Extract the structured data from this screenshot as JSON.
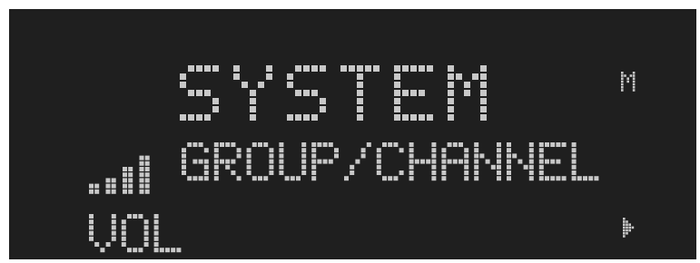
{
  "display": {
    "title": "SYSTEM",
    "subtitle": "GROUP/CHANNEL",
    "volume_label": "VOL",
    "mode_indicator": "M",
    "nav_indicator": "▶",
    "volume_level": {
      "bars_lit": 4,
      "bars_total": 4
    }
  },
  "colors": {
    "background": "#1f1f1f",
    "pixel_on": "#c8c8c8",
    "frame": "#ffffff"
  },
  "icons": {
    "volume": "signal-bars-icon",
    "navigation": "play-arrow-icon"
  }
}
